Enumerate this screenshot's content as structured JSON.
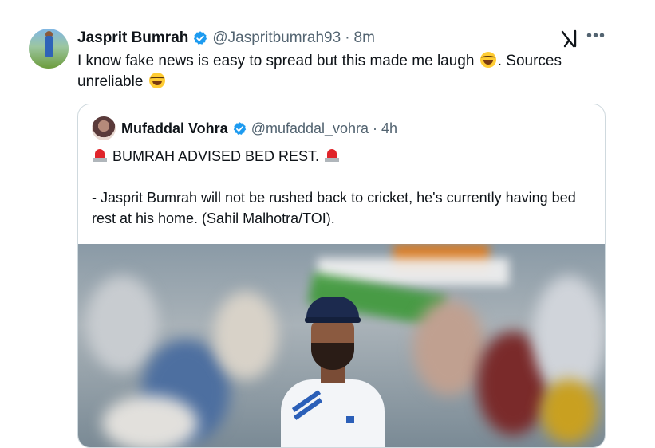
{
  "tweet": {
    "author_name": "Jasprit Bumrah",
    "handle": "@Jaspritbumrah93",
    "separator": "·",
    "time": "8m",
    "text_part1": "I know fake news is easy to spread but this made me laugh",
    "text_part2": ". Sources unreliable",
    "emoji_name": "laughing-with-tears-emoji"
  },
  "quote": {
    "author_name": "Mufaddal Vohra",
    "handle": "@mufaddal_vohra",
    "separator": "·",
    "time": "4h",
    "headline": "BUMRAH ADVISED BED REST.",
    "body": "- Jasprit Bumrah will not be rushed back to cricket, he's currently having bed rest at his home. (Sahil Malhotra/TOI)."
  },
  "icons": {
    "verified": "verified-badge-icon",
    "grok": "grok-icon",
    "more": "more-options-icon",
    "siren": "police-siren-icon"
  },
  "colors": {
    "verified_blue": "#1d9bf0",
    "text_primary": "#0f1419",
    "text_secondary": "#536471",
    "border": "#cfd9de"
  }
}
